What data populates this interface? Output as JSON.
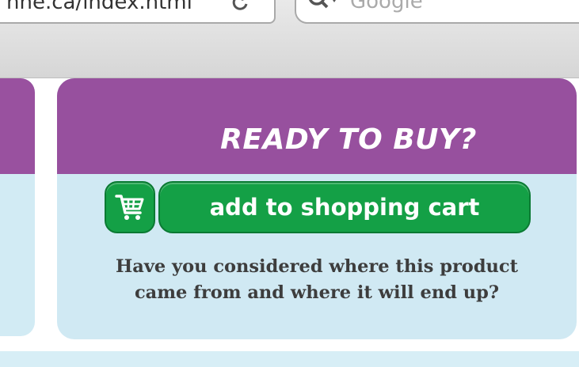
{
  "browser": {
    "url": "nne.ca/index.html",
    "search_placeholder": "Google"
  },
  "card": {
    "heading": "READY TO BUY?",
    "add_to_cart_label": "add to shopping cart",
    "question_line1": "Have you considered where this product",
    "question_line2": "came from and where it will end up?"
  },
  "icons": [
    "reload-icon",
    "search-icon",
    "shopping-cart-icon"
  ],
  "colors": {
    "header_purple": "#97509e",
    "panel_light_blue": "#d0e9f3",
    "button_green": "#14a046",
    "question_text": "#3d3d3d"
  }
}
